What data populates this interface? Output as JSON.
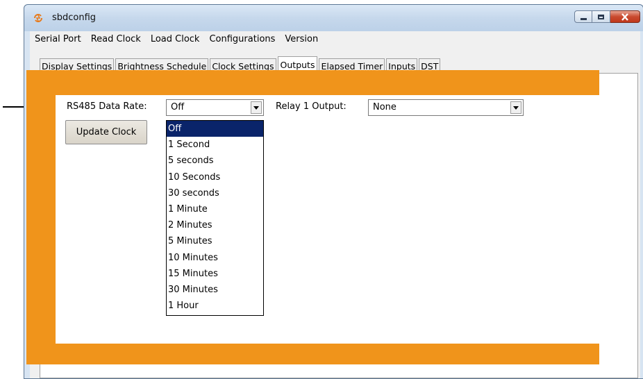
{
  "window": {
    "title": "sbdconfig",
    "controls": {
      "minimize": "minimize",
      "maximize": "maximize",
      "close": "close"
    }
  },
  "menubar": {
    "items": [
      "Serial Port",
      "Read Clock",
      "Load Clock",
      "Configurations",
      "Version"
    ]
  },
  "tabs": {
    "items": [
      "Display Settings",
      "Brightness Schedule",
      "Clock Settings",
      "Outputs",
      "Elapsed Timer",
      "Inputs",
      "DST"
    ],
    "active": "Outputs"
  },
  "outputs": {
    "rs485_label": "RS485 Data Rate:",
    "rs485_value": "Off",
    "relay1_label": "Relay 1 Output:",
    "relay1_value": "None",
    "update_button": "Update Clock"
  },
  "rs485_dropdown": {
    "options": [
      "Off",
      "1 Second",
      "5 seconds",
      "10 Seconds",
      "30 seconds",
      "1 Minute",
      "2 Minutes",
      "5 Minutes",
      "10 Minutes",
      "15 Minutes",
      "30 Minutes",
      "1 Hour"
    ],
    "selected": "Off"
  },
  "colors": {
    "panel_orange": "#f0941b",
    "selection_blue": "#0a246a",
    "close_red": "#c94a2f"
  },
  "icons": {
    "app": "sbdconfig-app-icon",
    "combo_arrow": "chevron-down-icon",
    "annotation": "arrow-right-icon"
  }
}
